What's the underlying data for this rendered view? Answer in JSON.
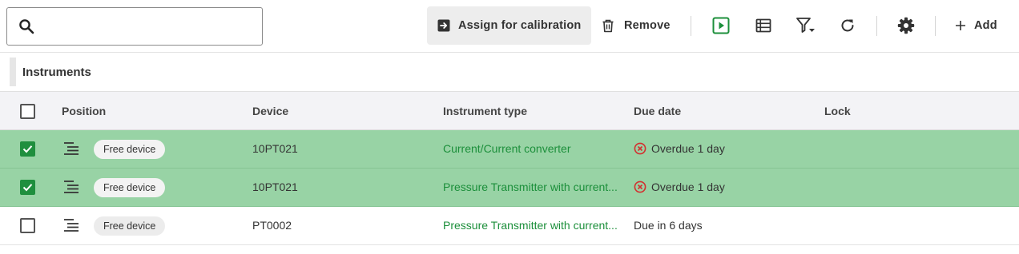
{
  "search": {
    "placeholder": "",
    "value": ""
  },
  "toolbar": {
    "assign_label": "Assign for calibration",
    "remove_label": "Remove",
    "add_label": "Add"
  },
  "section": {
    "title": "Instruments"
  },
  "table": {
    "headers": {
      "position": "Position",
      "device": "Device",
      "instrument_type": "Instrument type",
      "due_date": "Due date",
      "lock": "Lock"
    },
    "rows": [
      {
        "selected": true,
        "tag": "Free device",
        "device": "10PT021",
        "instrument_type": "Current/Current converter",
        "due": "Overdue 1 day",
        "overdue": true,
        "lock": ""
      },
      {
        "selected": true,
        "tag": "Free device",
        "device": "10PT021",
        "instrument_type": "Pressure Transmitter with current...",
        "due": "Overdue 1 day",
        "overdue": true,
        "lock": ""
      },
      {
        "selected": false,
        "tag": "Free device",
        "device": "PT0002",
        "instrument_type": "Pressure Transmitter with current...",
        "due": "Due in 6 days",
        "overdue": false,
        "lock": ""
      }
    ]
  },
  "colors": {
    "accent_green": "#1c8f3b",
    "selected_row": "#98d3a5",
    "overdue_red": "#d32f2f"
  }
}
